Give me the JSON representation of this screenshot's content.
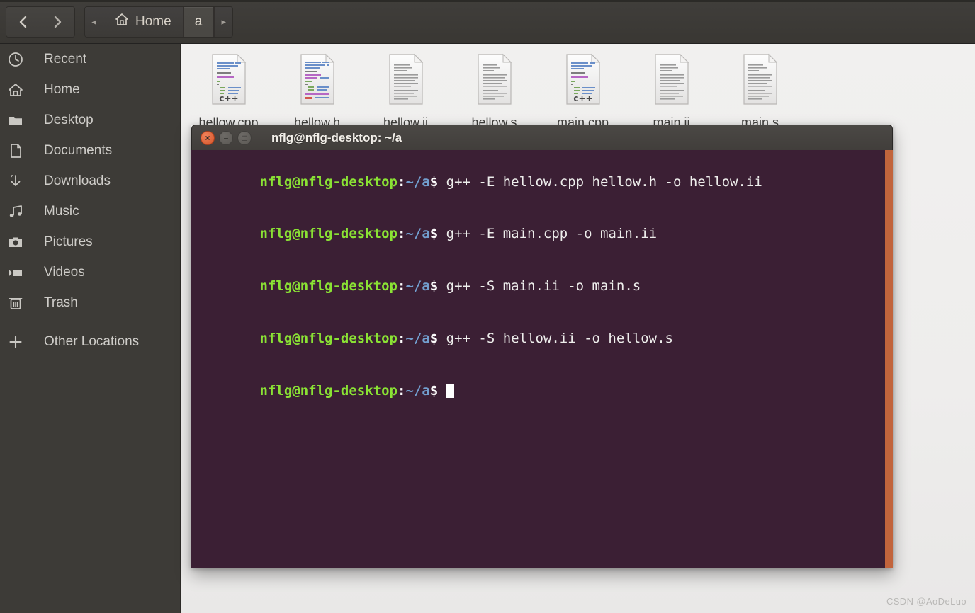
{
  "header": {
    "nav": [
      {
        "name": "back",
        "icon": "chevron-left-icon",
        "label": "Back"
      },
      {
        "name": "forward",
        "icon": "chevron-right-icon",
        "label": "Forward"
      }
    ],
    "breadcrumb": {
      "left_arrow": "◂",
      "right_arrow": "▸",
      "items": [
        {
          "label": "Home",
          "icon": "home-icon",
          "active": false
        },
        {
          "label": "a",
          "icon": "",
          "active": true
        }
      ]
    }
  },
  "sidebar": {
    "items": [
      {
        "label": "Recent",
        "icon": "clock-icon"
      },
      {
        "label": "Home",
        "icon": "home-icon"
      },
      {
        "label": "Desktop",
        "icon": "folder-icon"
      },
      {
        "label": "Documents",
        "icon": "document-icon"
      },
      {
        "label": "Downloads",
        "icon": "download-icon"
      },
      {
        "label": "Music",
        "icon": "music-note-icon"
      },
      {
        "label": "Pictures",
        "icon": "camera-icon"
      },
      {
        "label": "Videos",
        "icon": "video-camera-icon"
      },
      {
        "label": "Trash",
        "icon": "trash-icon"
      }
    ],
    "other": {
      "label": "Other Locations",
      "icon": "plus-icon"
    }
  },
  "files": [
    {
      "name": "hellow.cpp",
      "icon": "cpp-file-icon",
      "badge": "c++",
      "style": "code-color"
    },
    {
      "name": "hellow.h",
      "icon": "header-file-icon",
      "badge": "",
      "style": "code-color"
    },
    {
      "name": "hellow.ii",
      "icon": "text-file-icon",
      "badge": "",
      "style": "plain-text"
    },
    {
      "name": "hellow.s",
      "icon": "text-file-icon",
      "badge": "",
      "style": "plain-text"
    },
    {
      "name": "main.cpp",
      "icon": "cpp-file-icon",
      "badge": "c++",
      "style": "code-color"
    },
    {
      "name": "main.ii",
      "icon": "text-file-icon",
      "badge": "",
      "style": "plain-text"
    },
    {
      "name": "main.s",
      "icon": "text-file-icon",
      "badge": "",
      "style": "plain-text"
    }
  ],
  "terminal": {
    "title": "nflg@nflg-desktop: ~/a",
    "buttons": {
      "close": "×",
      "minimize": "–",
      "maximize": "□"
    },
    "prompt": {
      "user": "nflg@nflg-desktop",
      "colon": ":",
      "path": "~/a",
      "dollar": "$"
    },
    "lines": [
      {
        "command": " g++ -E hellow.cpp hellow.h -o hellow.ii",
        "cursor": false
      },
      {
        "command": " g++ -E main.cpp -o main.ii",
        "cursor": false
      },
      {
        "command": " g++ -S main.ii -o main.s",
        "cursor": false
      },
      {
        "command": " g++ -S hellow.ii -o hellow.s",
        "cursor": false
      },
      {
        "command": " ",
        "cursor": true
      }
    ],
    "colors": {
      "background": "#3b1f34",
      "user": "#8ae234",
      "path": "#729fcf",
      "text": "#eeeeec",
      "scrollbar": "#c2643c"
    }
  },
  "watermark": {
    "text": "CSDN @AoDeLuo"
  }
}
